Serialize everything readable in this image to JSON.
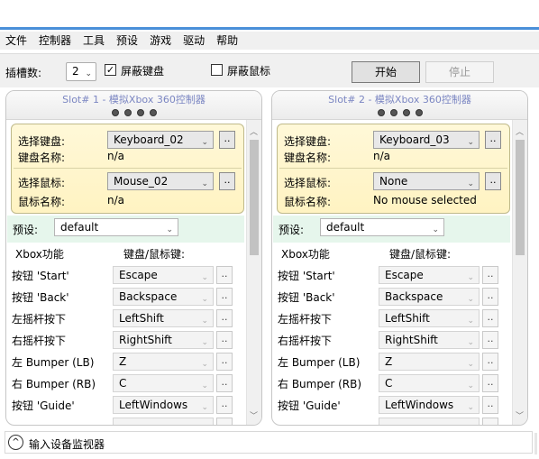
{
  "menu": [
    "文件",
    "控制器",
    "工具",
    "预设",
    "游戏",
    "驱动",
    "帮助"
  ],
  "toolbar": {
    "slots_label": "插槽数:",
    "slots_value": "2",
    "block_keyboard": {
      "label": "屏蔽键盘",
      "checked": true,
      "mark": "✓"
    },
    "block_mouse": {
      "label": "屏蔽鼠标",
      "checked": false,
      "mark": ""
    },
    "start_label": "开始",
    "stop_label": "停止"
  },
  "slots": [
    {
      "title": "Slot# 1 - 模拟Xbox 360控制器",
      "keyboard_select_label": "选择键盘:",
      "keyboard_value": "Keyboard_02",
      "keyboard_name_label": "键盘名称:",
      "keyboard_name": "n/a",
      "mouse_select_label": "选择鼠标:",
      "mouse_value": "Mouse_02",
      "mouse_name_label": "鼠标名称:",
      "mouse_name": "n/a",
      "preset_label": "预设:",
      "preset_value": "default",
      "col_xbox": "Xbox功能",
      "col_key": "键盘/鼠标键:",
      "mappings": [
        {
          "fn": "按钮 'Start'",
          "key": "Escape"
        },
        {
          "fn": "按钮 'Back'",
          "key": "Backspace"
        },
        {
          "fn": "左摇杆按下",
          "key": "LeftShift"
        },
        {
          "fn": "右摇杆按下",
          "key": "RightShift"
        },
        {
          "fn": "左 Bumper (LB)",
          "key": "Z"
        },
        {
          "fn": "右 Bumper (RB)",
          "key": "C"
        },
        {
          "fn": "按钮 'Guide'",
          "key": "LeftWindows"
        }
      ]
    },
    {
      "title": "Slot# 2 - 模拟Xbox 360控制器",
      "keyboard_select_label": "选择键盘:",
      "keyboard_value": "Keyboard_03",
      "keyboard_name_label": "键盘名称:",
      "keyboard_name": "n/a",
      "mouse_select_label": "选择鼠标:",
      "mouse_value": "None",
      "mouse_name_label": "鼠标名称:",
      "mouse_name": "No mouse selected",
      "preset_label": "预设:",
      "preset_value": "default",
      "col_xbox": "Xbox功能",
      "col_key": "键盘/鼠标键:",
      "mappings": [
        {
          "fn": "按钮 'Start'",
          "key": "Escape"
        },
        {
          "fn": "按钮 'Back'",
          "key": "Backspace"
        },
        {
          "fn": "左摇杆按下",
          "key": "LeftShift"
        },
        {
          "fn": "右摇杆按下",
          "key": "RightShift"
        },
        {
          "fn": "左 Bumper (LB)",
          "key": "Z"
        },
        {
          "fn": "右 Bumper (RB)",
          "key": "C"
        },
        {
          "fn": "按钮 'Guide'",
          "key": "LeftWindows"
        }
      ]
    }
  ],
  "common": {
    "browse_label": "..",
    "chevron": "⌄"
  },
  "icons": {
    "dropdown": "chevron-down-icon",
    "scroll_up": "chevron-up-icon",
    "scroll_down": "chevron-down-icon",
    "expand": "expand-up-icon"
  },
  "footer": {
    "label": "输入设备监视器",
    "expand_glyph": "^"
  },
  "colors": {
    "accent": "#4a90d9",
    "device_bg": "#fff5cc",
    "preset_bg": "#e6f6ec",
    "title": "#7b86c2"
  }
}
